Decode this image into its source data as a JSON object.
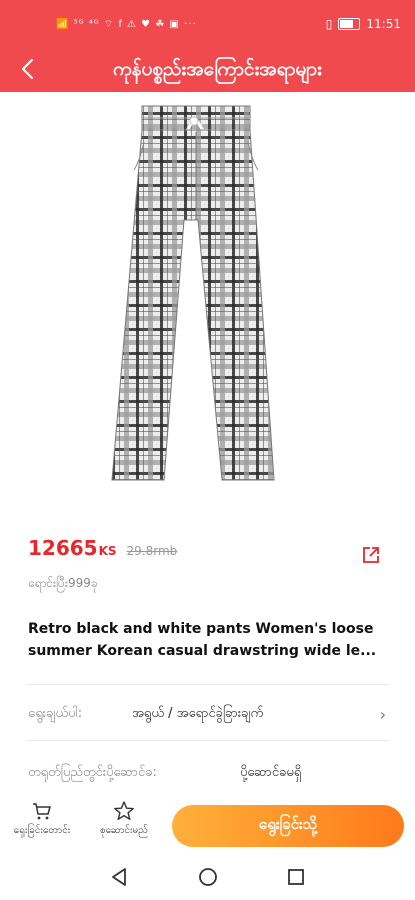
{
  "status_bar": {
    "icons_text": "📶 ⁵ᴳ ⁴ᴳ ⌔ f ⚠ ♥ ☘ ▣ ···",
    "time": "11:51"
  },
  "app_bar": {
    "title": "ကုန်ပစ္စည်းအကြောင်းအရာများ"
  },
  "product": {
    "price": "12665",
    "currency": "KS",
    "original_price": "29.8rmb",
    "sold_text": "ရောင်းပြီး999ခု",
    "title_line1": "Retro black and white pants Women's loose",
    "title_line2": "summer Korean casual drawstring wide le..."
  },
  "spec": {
    "label": "ရွေးချယ်ပါ:",
    "value": "အရွယ် / အရောင်ခွဲခြားချက်"
  },
  "shipping": {
    "label": "တရုတ်ပြည်တွင်းပို့ဆောင်ခ:",
    "value": "ပို့ဆောင်ခမရှိ"
  },
  "bottom_bar": {
    "cart_label": "ရှေးခြင်းတောင်း",
    "favorite_label": "စုဆောင်းမည်",
    "buy_label": "ရွေးခြင်းသို့"
  },
  "colors": {
    "brand": "#f04a4f",
    "price": "#e8262c",
    "buy_gradient_start": "#ffb03a",
    "buy_gradient_end": "#ff7a1a"
  }
}
